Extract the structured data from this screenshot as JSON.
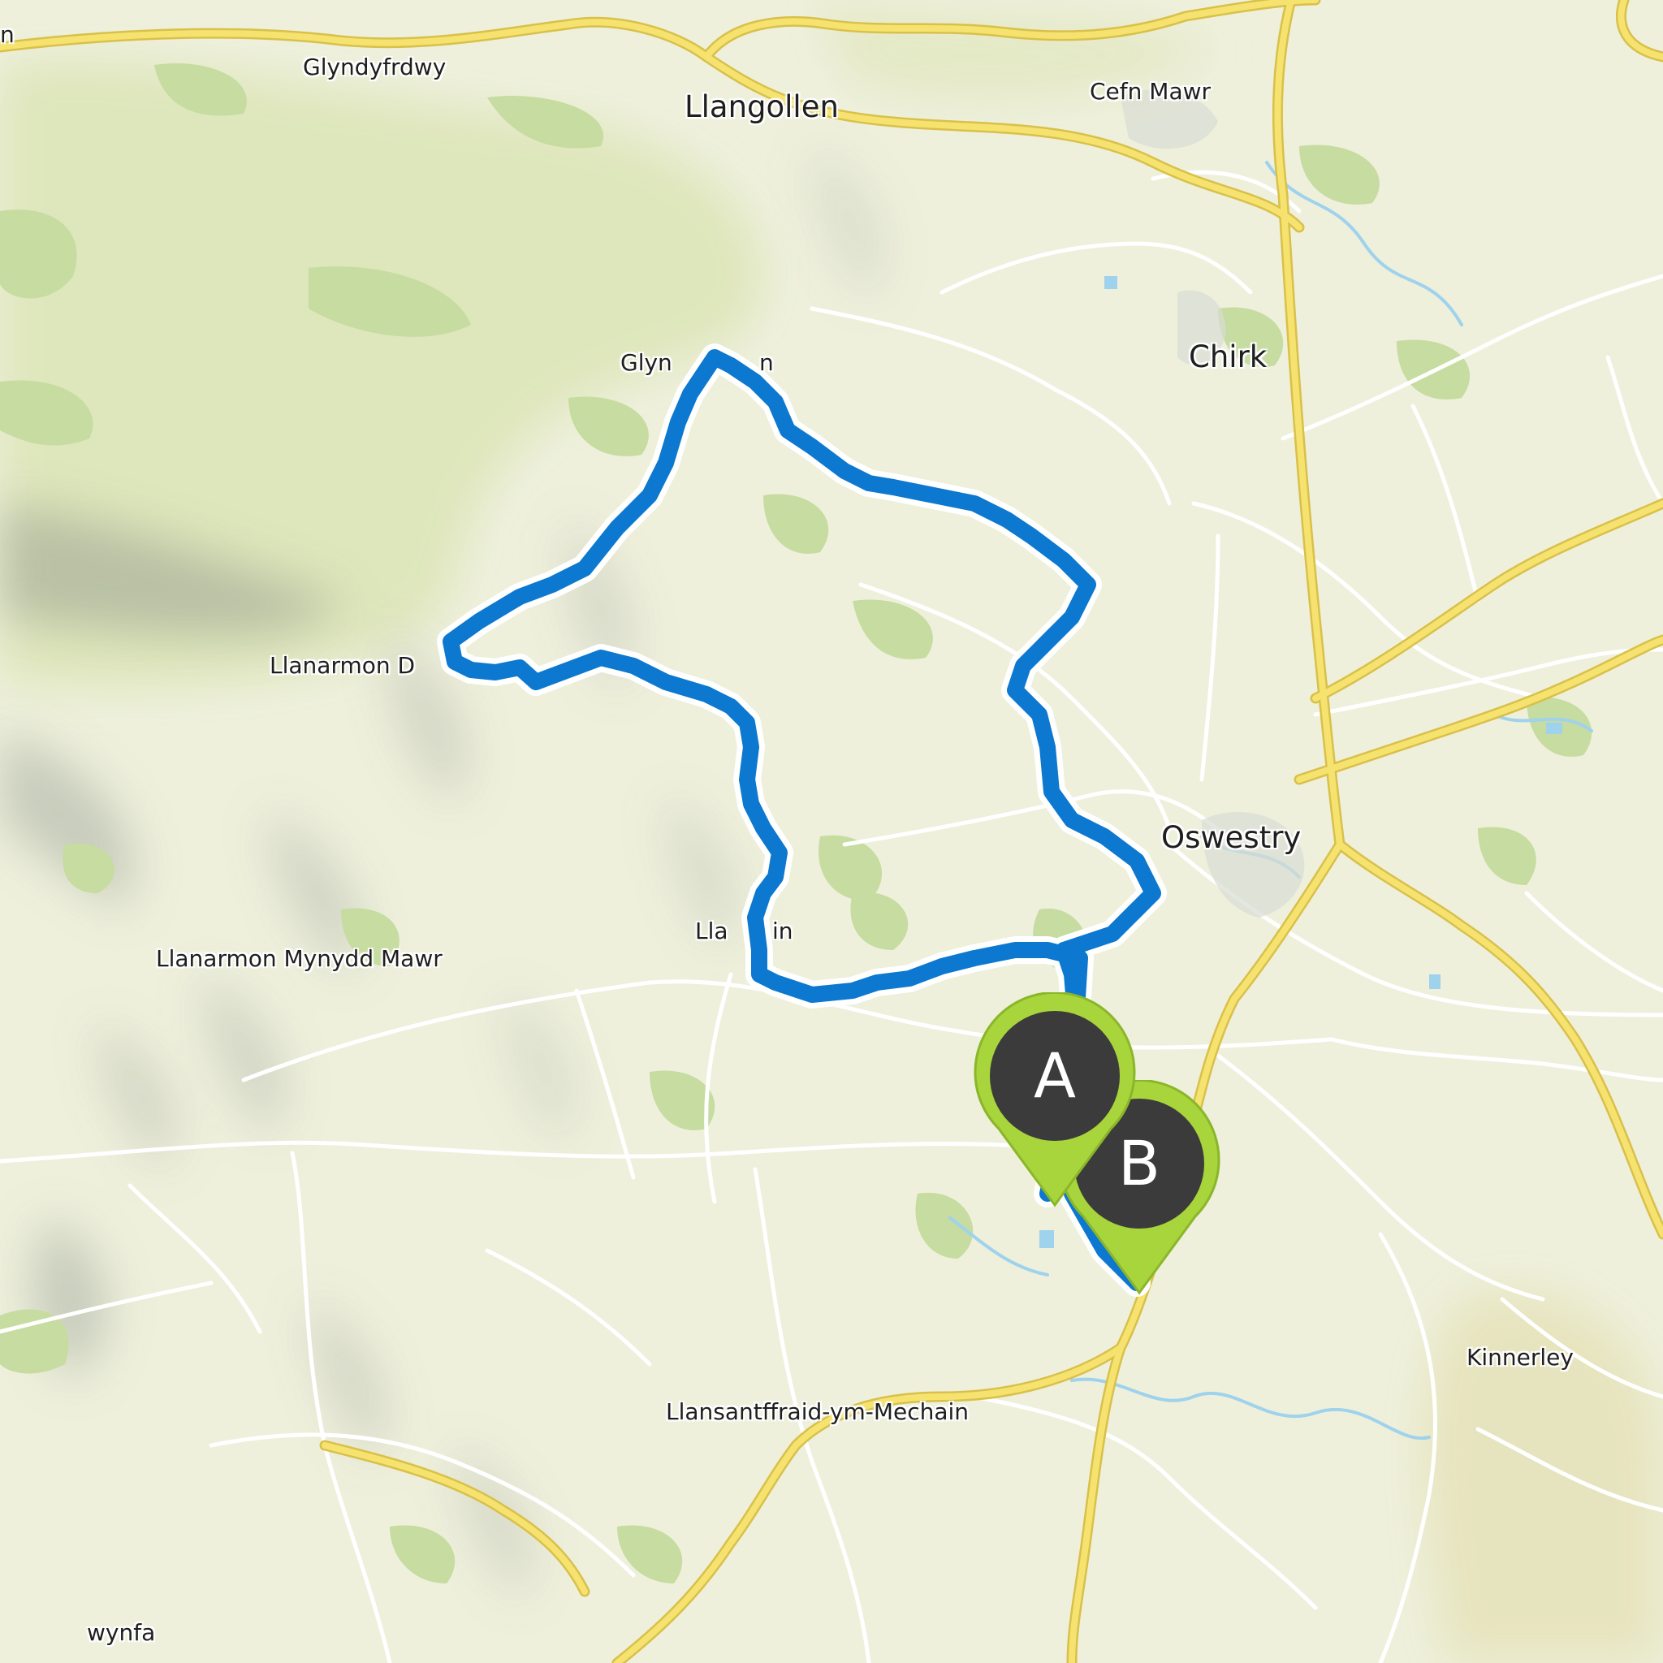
{
  "map": {
    "colors": {
      "land": "#eef0dc",
      "forest": "#c6dca0",
      "upland": "#dfe6bf",
      "hillshade": "#8f958a",
      "minor_road": "#ffffff",
      "major_road": "#f6e36f",
      "major_road_casing": "#d9c04a",
      "water": "#9fd2ec",
      "route": "#0c78cf",
      "route_casing": "#ffffff",
      "marker_fill": "#3b3b3b",
      "marker_ring": "#a8d43c"
    },
    "places": {
      "glyndyfrdwy": "Glyndyfrdwy",
      "llangollen": "Llangollen",
      "cefn_mawr": "Cefn Mawr",
      "chirk": "Chirk",
      "glyn_ceiriog_partial": "Glyn",
      "glyn_ceiriog_tail": "n",
      "llanarmon_dc_partial": "Llanarmon D",
      "oswestry": "Oswestry",
      "llansilin_partial": "Lla",
      "llansilin_tail": "in",
      "llanarmon_mynydd_mawr": "Llanarmon Mynydd Mawr",
      "kinnerley": "Kinnerley",
      "llansantffraid": "Llansantffraid-ym-Mechain",
      "edge_top_left": "n",
      "edge_bottom_left": "wynfa"
    },
    "markers": [
      {
        "label": "A",
        "role": "start"
      },
      {
        "label": "B",
        "role": "end"
      }
    ],
    "route_icon": "route-line",
    "marker_icon": "map-pin-icon"
  }
}
